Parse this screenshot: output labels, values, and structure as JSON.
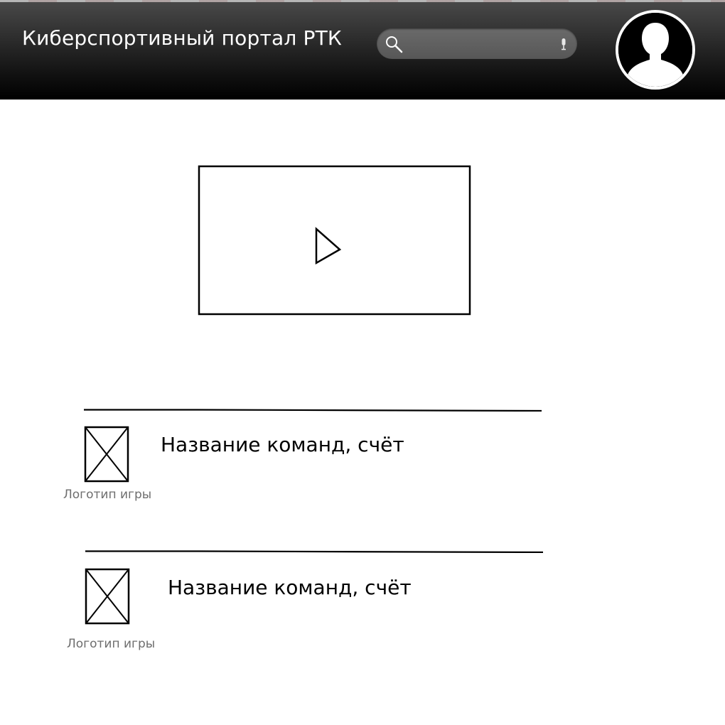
{
  "header": {
    "title": "Киберспортивный портал РТК",
    "search": {
      "placeholder": "",
      "value": ""
    },
    "icons": {
      "search": "search-icon",
      "mic": "microphone-icon",
      "avatar": "user-avatar-icon"
    },
    "colors": {
      "background_top": "#4a4a4a",
      "background_bottom": "#000000",
      "text": "#ffffff"
    }
  },
  "main": {
    "video": {
      "icon": "play-icon"
    },
    "matches": [
      {
        "title": "Название команд, счёт",
        "logo_caption": "Логотип игры",
        "logo_icon": "image-placeholder-icon"
      },
      {
        "title": "Название команд, счёт",
        "logo_caption": "Логотип игры",
        "logo_icon": "image-placeholder-icon"
      }
    ]
  }
}
